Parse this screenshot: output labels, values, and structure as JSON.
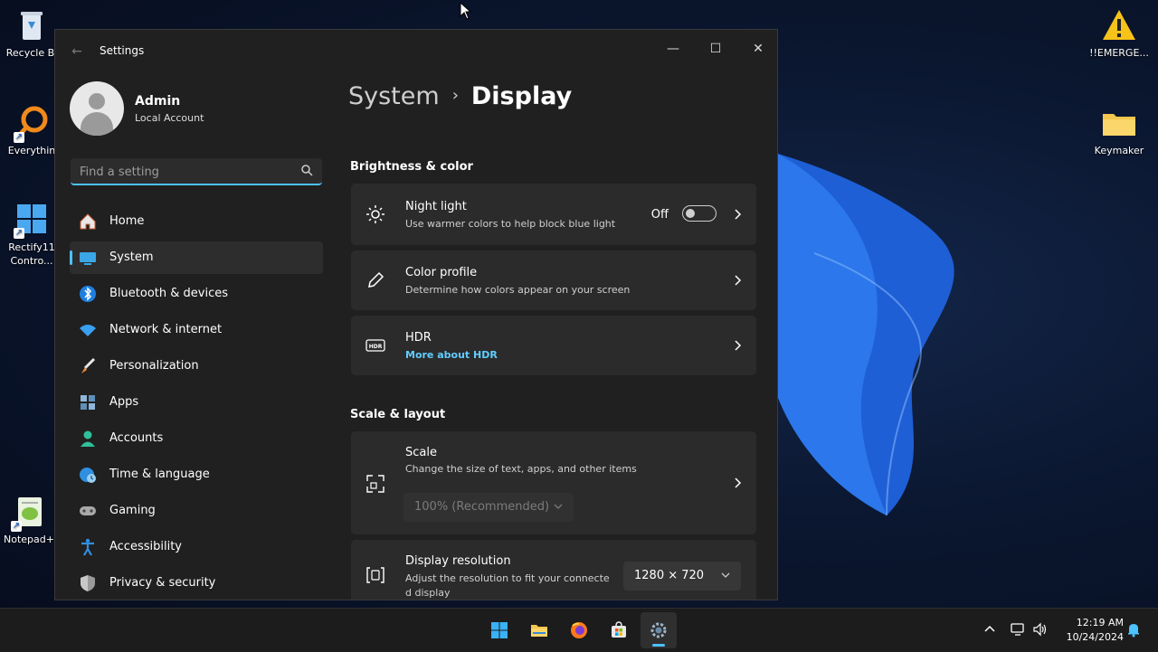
{
  "desktop": {
    "icons": [
      {
        "label": "Recycle Bi"
      },
      {
        "label": "Everythin"
      },
      {
        "label": "Rectify11 Contro..."
      },
      {
        "label": "Notepad+"
      },
      {
        "label": "!!EMERGE..."
      },
      {
        "label": "Keymaker"
      }
    ]
  },
  "window": {
    "title": "Settings",
    "controls": {
      "minimize": "—",
      "maximize": "☐",
      "close": "✕"
    }
  },
  "profile": {
    "name": "Admin",
    "account_type": "Local Account"
  },
  "search": {
    "placeholder": "Find a setting",
    "value": ""
  },
  "nav": {
    "items": [
      {
        "label": "Home",
        "icon": "home-icon"
      },
      {
        "label": "System",
        "icon": "system-icon",
        "active": true
      },
      {
        "label": "Bluetooth & devices",
        "icon": "bluetooth-icon"
      },
      {
        "label": "Network & internet",
        "icon": "wifi-icon"
      },
      {
        "label": "Personalization",
        "icon": "brush-icon"
      },
      {
        "label": "Apps",
        "icon": "apps-icon"
      },
      {
        "label": "Accounts",
        "icon": "accounts-icon"
      },
      {
        "label": "Time & language",
        "icon": "globe-clock-icon"
      },
      {
        "label": "Gaming",
        "icon": "gamepad-icon"
      },
      {
        "label": "Accessibility",
        "icon": "accessibility-icon"
      },
      {
        "label": "Privacy & security",
        "icon": "shield-icon"
      }
    ]
  },
  "breadcrumb": {
    "parent": "System",
    "separator": "›",
    "current": "Display"
  },
  "sections": {
    "brightness": {
      "title": "Brightness & color"
    },
    "scale_layout": {
      "title": "Scale & layout"
    }
  },
  "cards": {
    "night_light": {
      "title": "Night light",
      "subtitle": "Use warmer colors to help block blue light",
      "toggle_label": "Off",
      "enabled": false
    },
    "color_profile": {
      "title": "Color profile",
      "subtitle": "Determine how colors appear on your screen"
    },
    "hdr": {
      "title": "HDR",
      "link": "More about HDR"
    },
    "scale": {
      "title": "Scale",
      "subtitle": "Change the size of text, apps, and other items",
      "value": "100% (Recommended)"
    },
    "resolution": {
      "title": "Display resolution",
      "subtitle": "Adjust the resolution to fit your connecte d display",
      "value": "1280 × 720"
    }
  },
  "taskbar": {
    "apps": [
      "start-icon",
      "file-explorer-icon",
      "firefox-icon",
      "store-icon",
      "settings-icon"
    ],
    "active_app": "settings-icon"
  },
  "tray": {
    "time": "12:19 AM",
    "date": "10/24/2024"
  },
  "colors": {
    "accent": "#4cc2ff",
    "link": "#60cdff",
    "window_bg": "#202020",
    "card_bg": "#2b2b2b"
  }
}
